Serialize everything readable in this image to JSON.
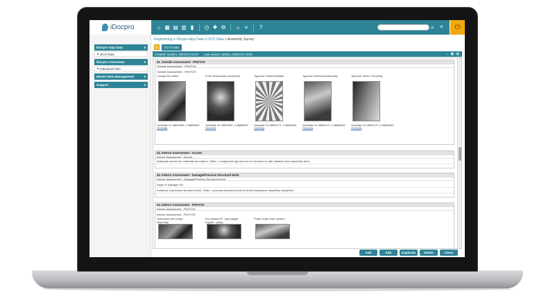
{
  "app": {
    "logo_text": "iDocpro"
  },
  "breadcrumb": {
    "root": "Engineering",
    "sep": " > ",
    "p1": "iDocpro App Data",
    "p2": "DCO Data",
    "current": "Assembly Survey"
  },
  "tabs": {
    "active": "DCO Data"
  },
  "doc_bar": {
    "created": "Created: System, 20/01/16 15:57",
    "last_viewed": "Last viewed: system, 20/01/16 15:56"
  },
  "sidebar": {
    "sections": [
      {
        "label": "iDocpro App Data",
        "badge": "0",
        "items": [
          "DCO Data"
        ]
      },
      {
        "label": "iDocpro Overviews",
        "badge": "0",
        "items": [
          "Individual Files"
        ]
      },
      {
        "label": "Master Data Management",
        "badge": "0",
        "items": []
      },
      {
        "label": "Support",
        "badge": "0",
        "items": []
      }
    ]
  },
  "sections": [
    {
      "title": "41. Outside Assessment - PHOTOS",
      "sub": "Outside Assessment - PHOTOS",
      "inner": "Outside Assessment - PHOTOS",
      "photos": [
        {
          "caption": "Cockpit Air Intake",
          "geo": "GeoData: 51.38547896 -2.38858967",
          "link": "GeoData"
        },
        {
          "caption": "Front Suspension Assembly",
          "geo": "GeoData: 51.38547896 -2.38858967",
          "link": "GeoData"
        },
        {
          "caption": "Typhoon Turbine Blades",
          "geo": "GeoData: 51.38551173 -2.38681661",
          "link": "GeoData"
        },
        {
          "caption": "Typhoon Electrical Assembly",
          "geo": "GeoData: 51.38551173 -2.38681661",
          "link": "GeoData"
        },
        {
          "caption": "Typhoon Vector Thrusting",
          "geo": "GeoData: 51.38551173 -2.38681661",
          "link": "GeoData"
        }
      ]
    },
    {
      "title": "42. Interior Assessment - Access",
      "sub": "Interior Assessment - Access",
      "line1": "Adequate access for materials and labour. Other = component rigs need to be removed to safe distance from assembly area"
    },
    {
      "title": "43. Interior Assessment - Damage/Previous Structural Work",
      "sub": "Interior Assessment - Damage/Previous Structural Work",
      "line1": "Signs of Damage: No",
      "line2": "Evidence of previous structural work. Other = previous structural work for front suspension assembly completed"
    },
    {
      "title": "44. Interior Assessment - PHOTOS",
      "sub": "Interior Assessment - PHOTOS",
      "inner": "Interior Assessment - PHOTOS",
      "photos": [
        {
          "caption": "Hydraulics fuel pump assembly"
        },
        {
          "caption": "Dry damped F- type jaguar engine - pump"
        },
        {
          "caption": "Pump chain drive system"
        }
      ]
    }
  ],
  "buttons": {
    "add": "Add",
    "edit": "Edit",
    "duplicate": "Duplicate",
    "delete": "Delete",
    "close": "Close"
  }
}
